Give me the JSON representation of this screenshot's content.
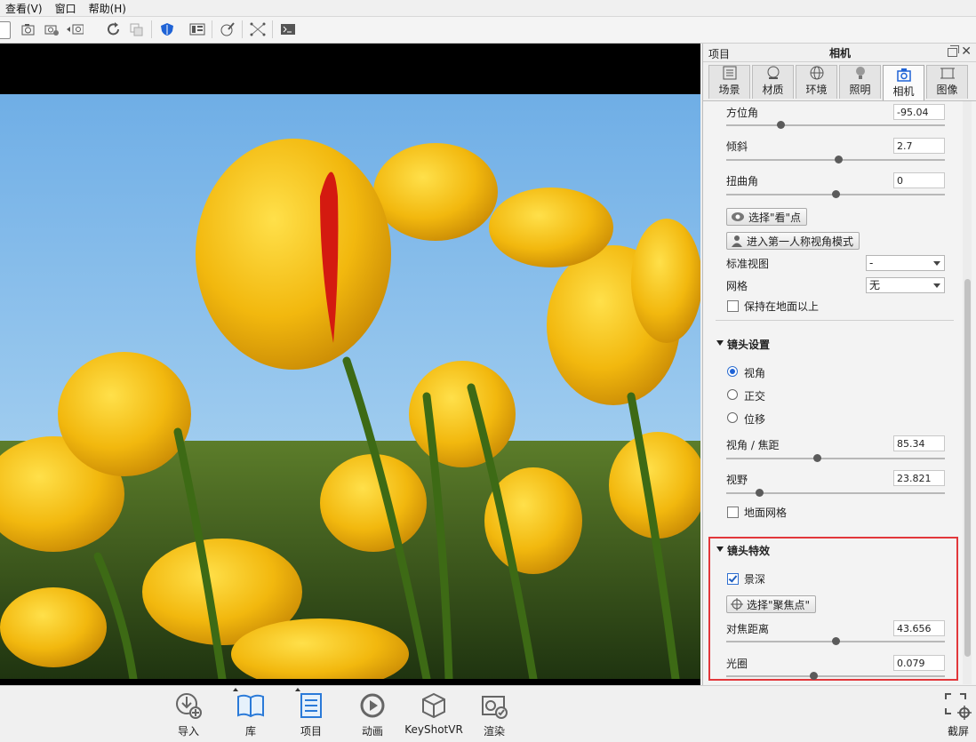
{
  "menu": [
    "查看(V)",
    "窗口",
    "帮助(H)"
  ],
  "panel": {
    "left_title": "项目",
    "title": "相机",
    "tabs": [
      "场景",
      "材质",
      "环境",
      "照明",
      "相机",
      "图像"
    ],
    "active_tab": "相机",
    "azimuth": {
      "label": "方位角",
      "value": "-95.04",
      "level": 0.25
    },
    "inclination": {
      "label": "倾斜",
      "value": "2.7",
      "level": 0.52
    },
    "twist": {
      "label": "扭曲角",
      "value": "0",
      "level": 0.5
    },
    "pick_look_at": "选择\"看\"点",
    "first_person": "进入第一人称视角模式",
    "standard_view": {
      "label": "标准视图",
      "value": "-"
    },
    "grid": {
      "label": "网格",
      "value": "无"
    },
    "keep_above_ground": "保持在地面以上",
    "lens_settings": {
      "title": "镜头设置",
      "options": [
        "视角",
        "正交",
        "位移"
      ],
      "selected": "视角",
      "fov_focal": {
        "label": "视角 / 焦距",
        "value": "85.34",
        "level": 0.38
      },
      "field_of_view": {
        "label": "视野",
        "value": "23.821",
        "level": 0.11
      },
      "ground_grid": "地面网格"
    },
    "lens_effects": {
      "title": "镜头特效",
      "dof": "景深",
      "dof_checked": true,
      "pick_focus": "选择\"聚焦点\"",
      "focus_distance": {
        "label": "对焦距离",
        "value": "43.656",
        "level": 0.5
      },
      "f_stop": {
        "label": "光圈",
        "value": "0.079",
        "level": 0.4
      }
    }
  },
  "bottom": [
    "导入",
    "库",
    "项目",
    "动画",
    "KeyShotVR",
    "渲染"
  ],
  "fullscreen": "截屏",
  "colors": {
    "accent": "#1f63d6",
    "highlight": "#e2373b",
    "sky": "#7fb9ea"
  }
}
